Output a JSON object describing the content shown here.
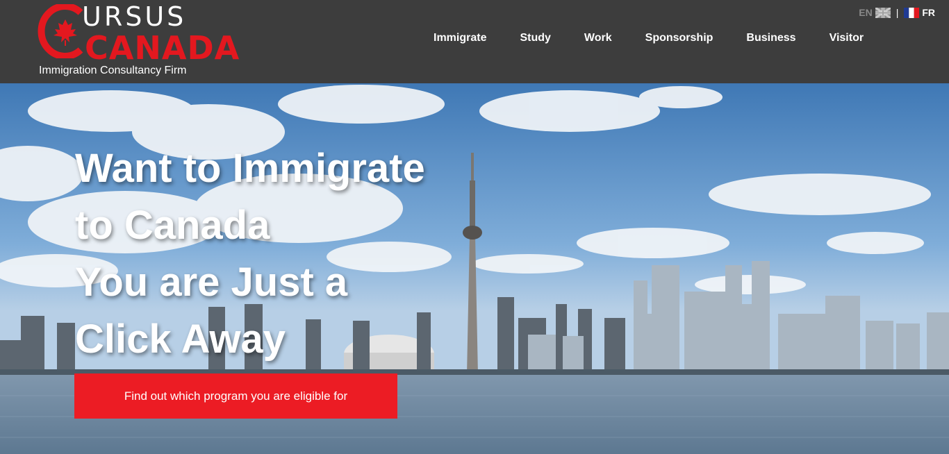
{
  "logo": {
    "top_text": "URSUS",
    "bottom_text": "CANADA",
    "tagline": "Immigration Consultancy Firm"
  },
  "language": {
    "en": "EN",
    "separator": "|",
    "fr": "FR"
  },
  "nav": {
    "items": [
      {
        "label": "Immigrate"
      },
      {
        "label": "Study"
      },
      {
        "label": "Work"
      },
      {
        "label": "Sponsorship"
      },
      {
        "label": "Business"
      },
      {
        "label": "Visitor"
      }
    ]
  },
  "hero": {
    "headline_lines": [
      "Want to Immigrate",
      "to Canada",
      "You are Just a",
      "Click Away"
    ],
    "cta_label": "Find out which program you are eligible for"
  },
  "colors": {
    "header_bg": "#3d3d3d",
    "brand_red": "#ec1c24"
  }
}
